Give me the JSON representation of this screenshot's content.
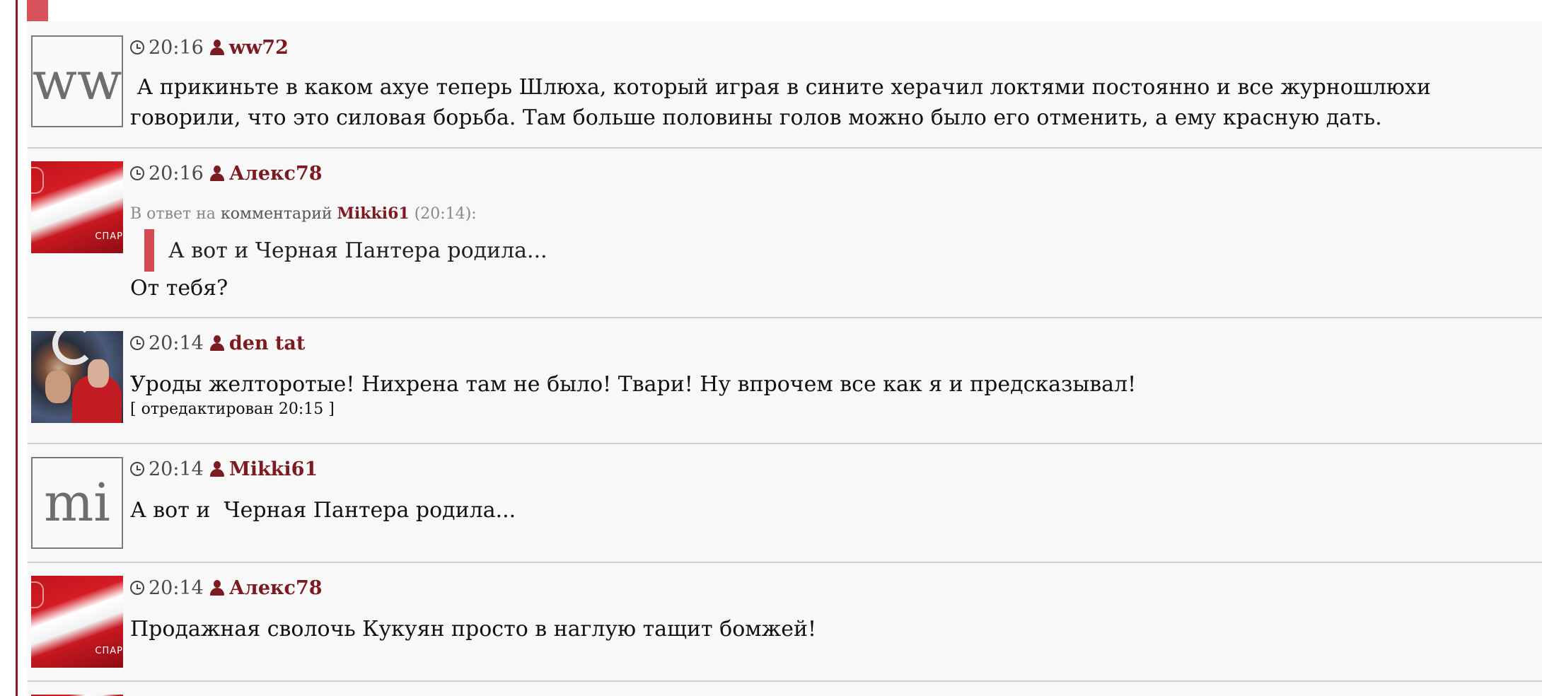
{
  "comments": [
    {
      "time": "20:16",
      "author": "ww72",
      "avatar": {
        "type": "letters",
        "letters": "ww"
      },
      "text": " А прикиньте в каком ахуе теперь Шлюха, который играя в сините херачил локтями постоянно и все журношлюхи говорили, что это силовая борьба. Там больше половины голов можно было его отменить, а ему красную дать."
    },
    {
      "time": "20:16",
      "author": "Алекс78",
      "avatar": {
        "type": "image",
        "icon": "spartak-flag",
        "caption": "СПАР"
      },
      "reply": {
        "prefix": "В ответ на",
        "word": "комментарий",
        "author": "Mikki61",
        "time": "(20:14):",
        "quote": "А вот и  Черная Пантера родила..."
      },
      "text": "От тебя?"
    },
    {
      "time": "20:14",
      "author": "den tat",
      "avatar": {
        "type": "image",
        "icon": "spartak-players-photo"
      },
      "text": "Уроды желторотые! Нихрена там не было! Твари! Ну впрочем все как я и предсказывал!",
      "edited": "[ отредактирован 20:15 ]"
    },
    {
      "time": "20:14",
      "author": "Mikki61",
      "avatar": {
        "type": "letters",
        "letters": "mi"
      },
      "text": "А вот и  Черная Пантера родила..."
    },
    {
      "time": "20:14",
      "author": "Алекс78",
      "avatar": {
        "type": "image",
        "icon": "spartak-flag",
        "caption": "СПАР"
      },
      "text": "Продажная сволочь Кукуян просто в наглую тащит бомжей!"
    }
  ],
  "colors": {
    "accent": "#7b1a20",
    "rail": "#8b1c24",
    "quote_bar": "#d24a52",
    "background": "#f8f8f8"
  }
}
